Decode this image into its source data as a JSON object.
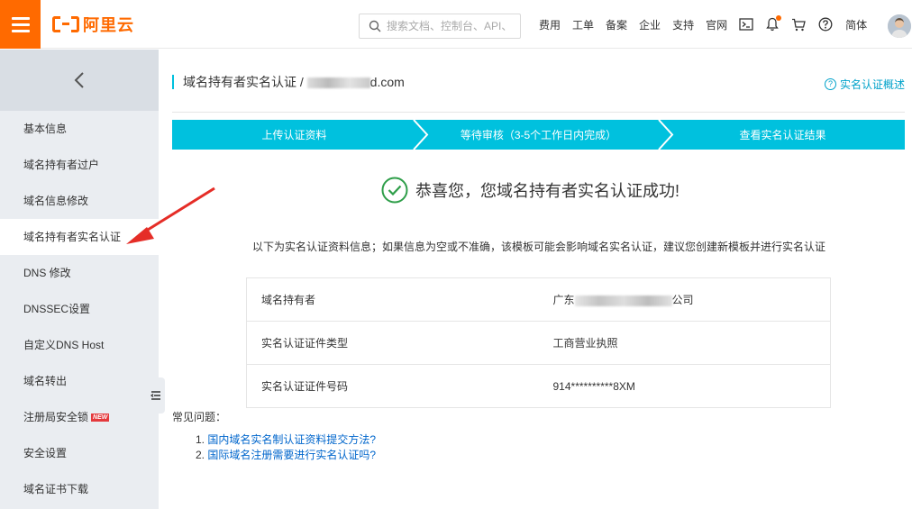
{
  "header": {
    "logo_text": "阿里云",
    "search_placeholder": "搜索文档、控制台、API、",
    "nav": [
      "费用",
      "工单",
      "备案",
      "企业",
      "支持",
      "官网"
    ],
    "lang": "简体",
    "brand_color": "#ff6a00"
  },
  "sidebar": {
    "items": [
      {
        "label": "基本信息"
      },
      {
        "label": "域名持有者过户"
      },
      {
        "label": "域名信息修改"
      },
      {
        "label": "域名持有者实名认证"
      },
      {
        "label": "DNS 修改"
      },
      {
        "label": "DNSSEC设置"
      },
      {
        "label": "自定义DNS Host"
      },
      {
        "label": "域名转出"
      },
      {
        "label": "注册局安全锁",
        "badge": "NEW"
      },
      {
        "label": "安全设置"
      },
      {
        "label": "域名证书下载"
      }
    ],
    "active_index": 3
  },
  "main": {
    "breadcrumb_prefix": "域名持有者实名认证 / ",
    "breadcrumb_suffix": "d.com",
    "overview_link": "实名认证概述",
    "steps": [
      "上传认证资料",
      "等待审核（3-5个工作日内完成）",
      "查看实名认证结果"
    ],
    "success_message": "恭喜您，您域名持有者实名认证成功!",
    "info_text": "以下为实名认证资料信息；如果信息为空或不准确，该模板可能会影响域名实名认证，建议您创建新模板并进行实名认证",
    "info_rows": [
      {
        "label": "域名持有者",
        "value_prefix": "广东",
        "value_suffix": "公司"
      },
      {
        "label": "实名认证证件类型",
        "value": "工商营业执照"
      },
      {
        "label": "实名认证证件号码",
        "value": "914**********8XM"
      }
    ],
    "faq_title": "常见问题：",
    "faq": [
      {
        "num": "1.",
        "text": "国内域名实名制认证资料提交方法?"
      },
      {
        "num": "2.",
        "text": "国际域名注册需要进行实名认证吗?"
      }
    ],
    "accent_color": "#00c1de",
    "success_color": "#2e9e49"
  }
}
